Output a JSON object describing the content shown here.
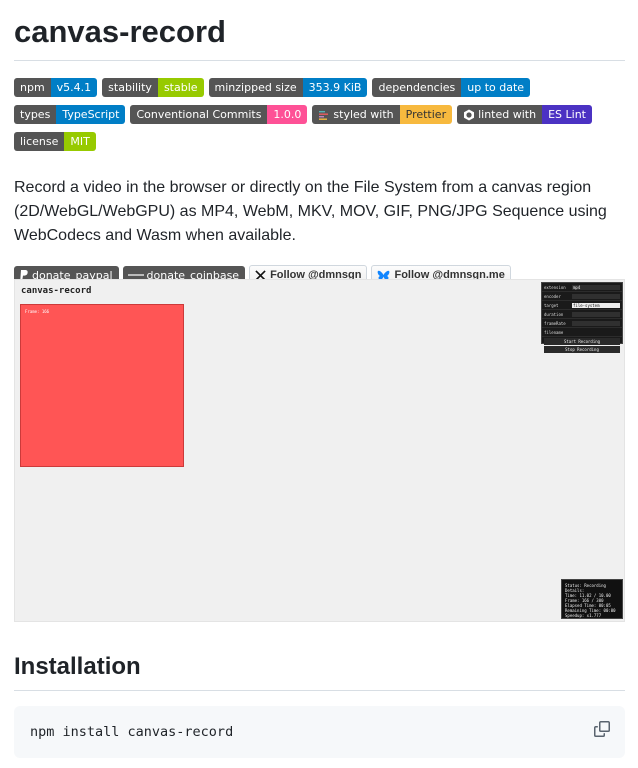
{
  "title": "canvas-record",
  "badges": [
    {
      "label": "npm",
      "value": "v5.4.1",
      "color": "#007ec6"
    },
    {
      "label": "stability",
      "value": "stable",
      "color": "#97ca00"
    },
    {
      "label": "minzipped size",
      "value": "353.9 KiB",
      "color": "#007ec6"
    },
    {
      "label": "dependencies",
      "value": "up to date",
      "color": "#007ec6"
    },
    {
      "label": "types",
      "value": "TypeScript",
      "color": "#007ec6"
    },
    {
      "label": "Conventional Commits",
      "value": "1.0.0",
      "color": "#fe5196"
    },
    {
      "label": "styled with",
      "value": "Prettier",
      "color": "#f7b93e",
      "icon": "prettier-icon"
    },
    {
      "label": "linted with",
      "value": "ES Lint",
      "color": "#4b32c3",
      "icon": "eslint-icon"
    },
    {
      "label": "license",
      "value": "MIT",
      "color": "#97ca00"
    }
  ],
  "description": "Record a video in the browser or directly on the File System from a canvas region (2D/WebGL/WebGPU) as MP4, WebM, MKV, MOV, GIF, PNG/JPG Sequence using WebCodecs and Wasm when available.",
  "social": [
    {
      "label": "donate",
      "value": "paypal",
      "icon": "paypal-icon",
      "type": "badge"
    },
    {
      "label": "donate",
      "value": "coinbase",
      "icon": "coinbase-icon",
      "type": "badge"
    },
    {
      "text": "Follow @dmnsgn",
      "icon": "x-icon",
      "type": "follow"
    },
    {
      "text": "Follow @dmnsgn.me",
      "icon": "bluesky-icon",
      "type": "follow"
    }
  ],
  "screenshot": {
    "title": "canvas-record",
    "frame_text": "Frame: 166",
    "gui_rows": [
      {
        "key": "extension",
        "value": "mp4"
      },
      {
        "key": "encoder",
        "value": ""
      },
      {
        "key": "target",
        "value": "file-system"
      },
      {
        "key": "duration",
        "value": ""
      },
      {
        "key": "frameRate",
        "value": ""
      },
      {
        "key": "filename",
        "value": ""
      }
    ],
    "gui_buttons": [
      "Start Recording",
      "Stop Recording"
    ],
    "stats_lines": [
      "Status: Recording",
      "Details:",
      "Time: 11.02 / 10.00",
      "Frame: 166 / 300",
      "Elapsed Time: 00:05",
      "Remaining Time: 00:00",
      "Speedup: x1.777"
    ]
  },
  "installation": {
    "heading": "Installation",
    "command": "npm install canvas-record"
  },
  "colors": {
    "badge_label": "#555555",
    "canvas_red": "#ff5555"
  }
}
